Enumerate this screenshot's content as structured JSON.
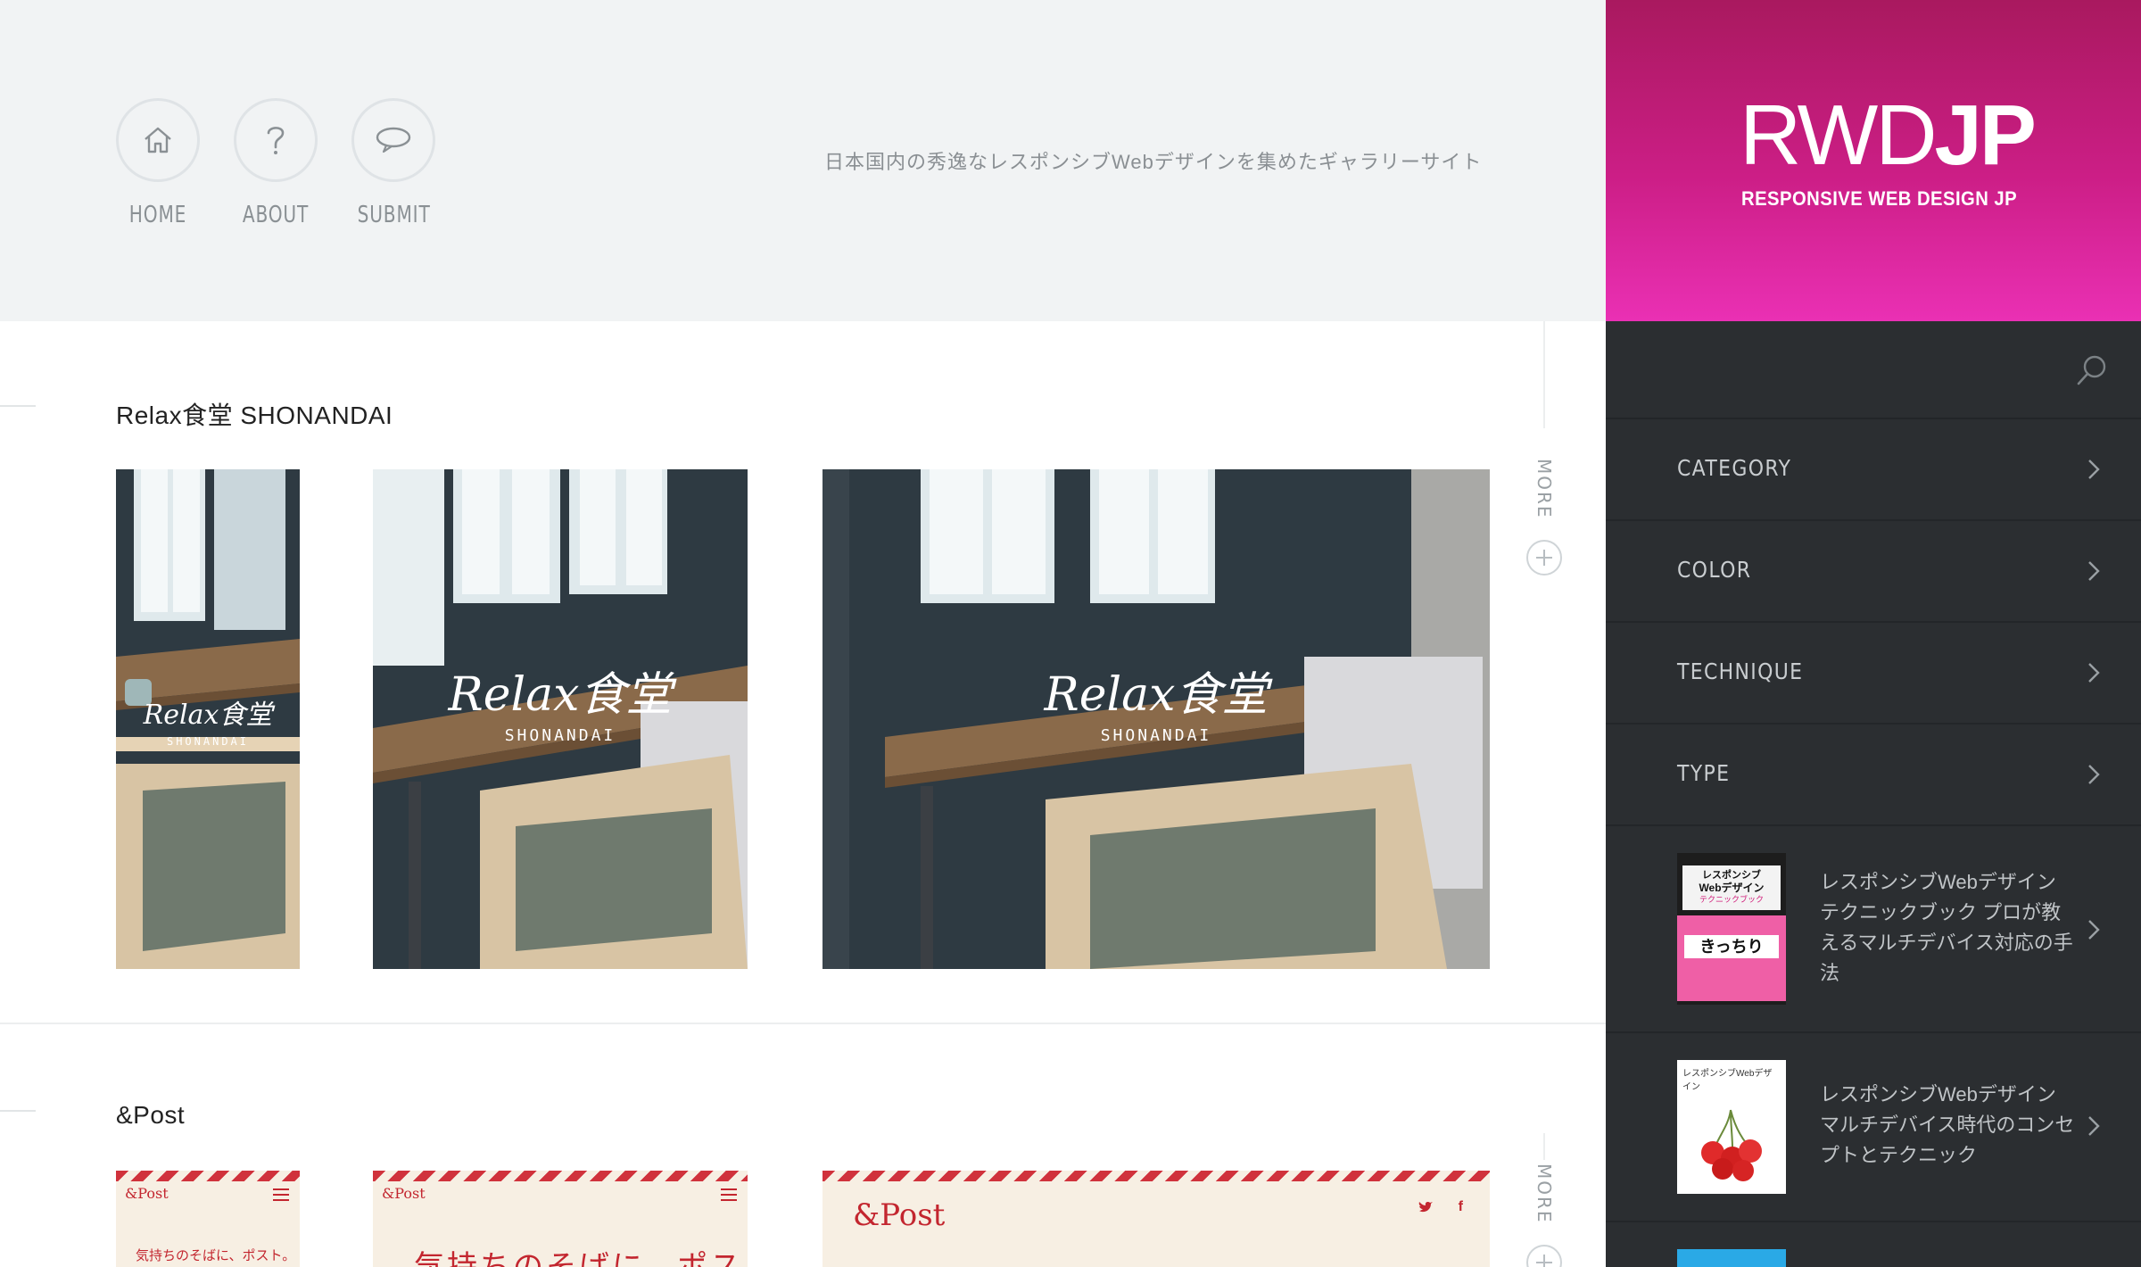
{
  "nav": {
    "items": [
      {
        "label": "HOME",
        "icon": "home-icon"
      },
      {
        "label": "ABOUT",
        "icon": "question-icon"
      },
      {
        "label": "SUBMIT",
        "icon": "speech-bubble-icon"
      }
    ],
    "tagline": "日本国内の秀逸なレスポンシブWebデザインを集めたギャラリーサイト"
  },
  "logo": {
    "main_light": "RWD",
    "main_bold": "JP",
    "sub": "RESPONSIVE WEB DESIGN JP",
    "gradient": [
      "#a9195f",
      "#ea30b4"
    ]
  },
  "sidebar": {
    "search_icon": "search-icon",
    "menu": [
      {
        "label": "CATEGORY"
      },
      {
        "label": "COLOR"
      },
      {
        "label": "TECHNIQUE"
      },
      {
        "label": "TYPE"
      }
    ],
    "books": [
      {
        "title": "レスポンシブWebデザイン テクニックブック プロが教えるマルチデバイス対応の手法",
        "cover_lines": [
          "レスポンシブ",
          "Webデザイン",
          "テクニックブック",
          "きっちり"
        ]
      },
      {
        "title": "レスポンシブWebデザイン マルチデバイス時代のコンセプトとテクニック",
        "cover_lines": [
          "レスポンシブWebデザイン"
        ]
      }
    ]
  },
  "sites": [
    {
      "title": "Relax食堂 SHONANDAI",
      "more": "MORE",
      "logo_script": "Relax食堂",
      "logo_sub": "SHONANDAI"
    },
    {
      "title": "&Post",
      "more": "MORE",
      "logo": "&Post",
      "copy_sp": "気持ちのそばに、ポスト。",
      "copy_tab": "気持ちのそばに、ポスト"
    }
  ],
  "colors": {
    "accent": "#cc1e86",
    "sidebar_bg": "#2b2e31",
    "header_bg": "#f1f3f4"
  }
}
